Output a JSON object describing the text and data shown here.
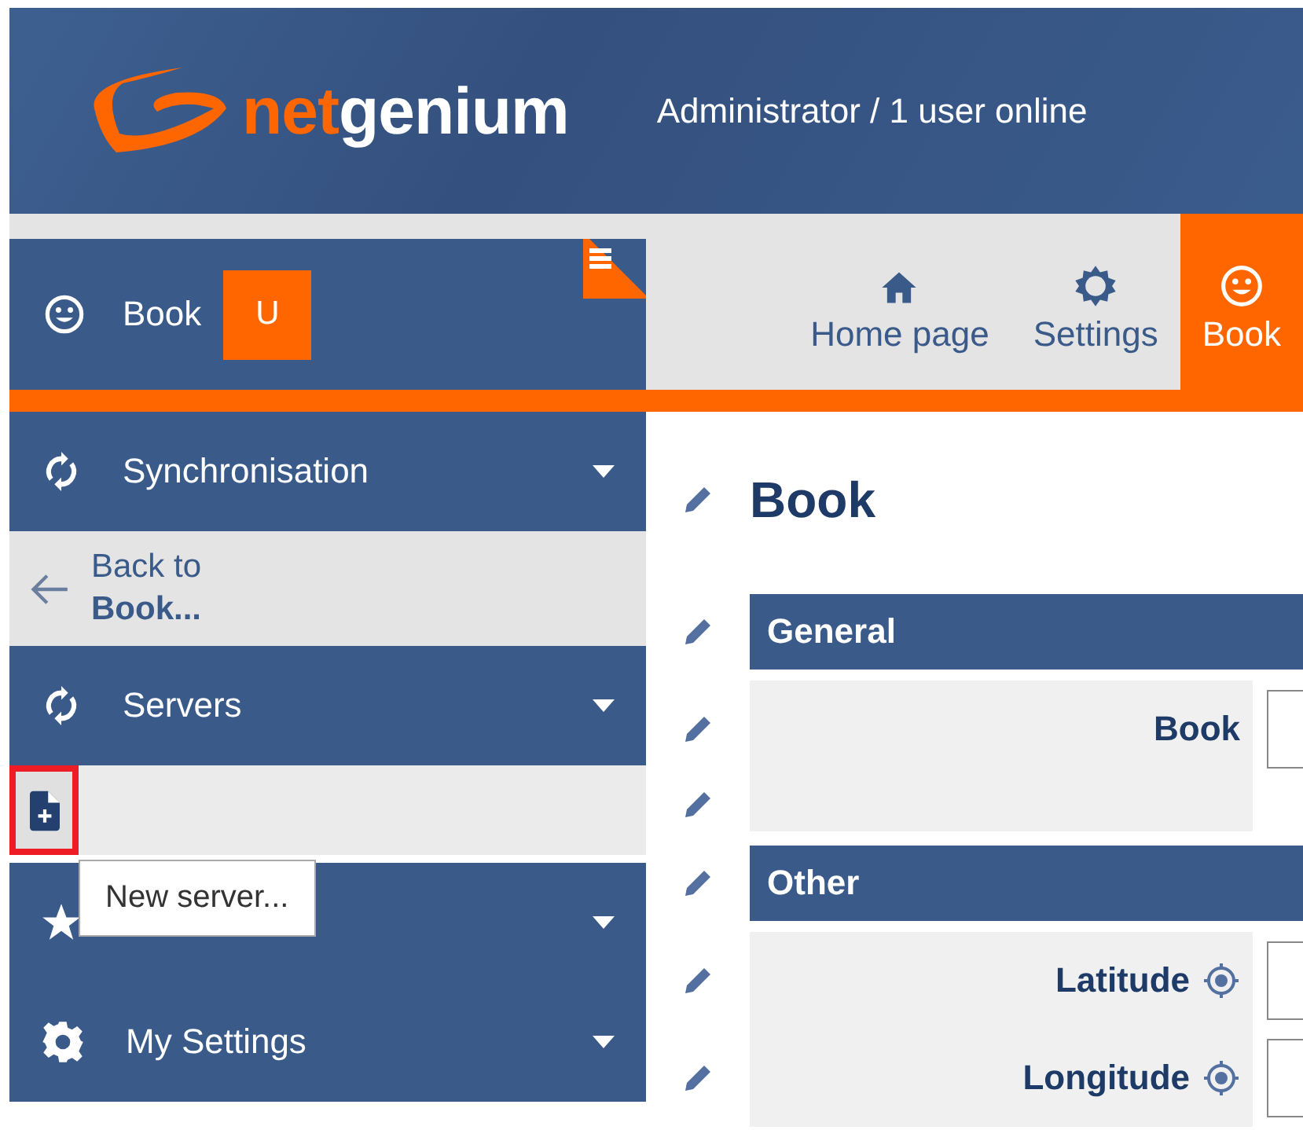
{
  "header": {
    "logo_accent": "net",
    "logo_rest": "genium",
    "user_status": "Administrator / 1 user online"
  },
  "module": {
    "label": "Book",
    "badge": "U"
  },
  "tabs": [
    {
      "kind": "home",
      "label": "Home page",
      "selected": false
    },
    {
      "kind": "gear",
      "label": "Settings",
      "selected": false
    },
    {
      "kind": "smiley",
      "label": "Book",
      "selected": true
    }
  ],
  "sidebar": [
    {
      "kind": "sync",
      "label": "Synchronisation"
    },
    {
      "kind": "back",
      "text": "Back to **Book...**"
    },
    {
      "kind": "sync",
      "label": "Servers"
    },
    {
      "kind": "toolbar",
      "highlighted": true,
      "tooltip": "New server..."
    },
    {
      "kind": "star"
    },
    {
      "kind": "settings",
      "label": "My Settings"
    }
  ],
  "main": {
    "title": "Book",
    "sections": [
      {
        "title": "General",
        "rows": [
          {
            "kind": "field",
            "label": "Book",
            "locate": false
          },
          {
            "kind": "spacer"
          }
        ]
      },
      {
        "title": "Other",
        "rows": [
          {
            "kind": "field",
            "label": "Latitude",
            "locate": true
          },
          {
            "kind": "field",
            "label": "Longitude",
            "locate": true
          }
        ]
      }
    ]
  }
}
